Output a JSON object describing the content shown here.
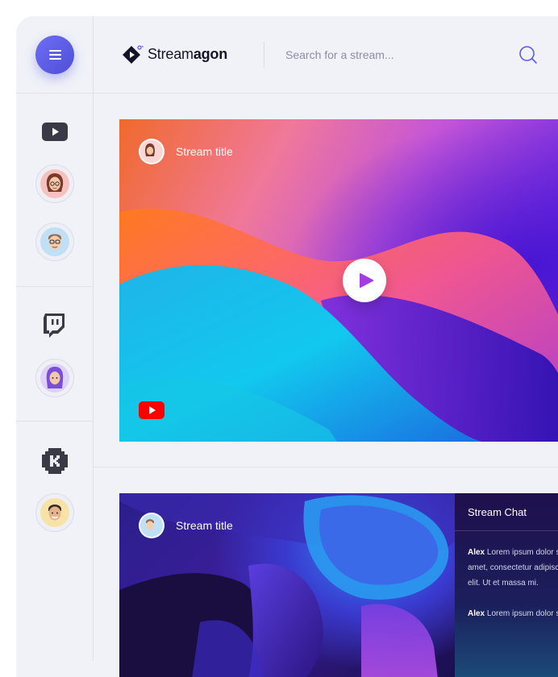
{
  "app": {
    "brand": {
      "name_regular": "Stream",
      "name_bold": "agon"
    },
    "search": {
      "placeholder": "Search for a stream..."
    }
  },
  "sidebar": {
    "groups": [
      {
        "platform": "youtube-icon",
        "channels": [
          "streamer-female-1",
          "streamer-male-glasses"
        ]
      },
      {
        "platform": "twitch-icon",
        "channels": [
          "streamer-female-purple"
        ]
      },
      {
        "platform": "kick-icon",
        "channels": [
          "streamer-male-2"
        ]
      }
    ]
  },
  "streams": [
    {
      "title": "Stream title",
      "platform": "youtube-icon"
    },
    {
      "title": "Stream title"
    }
  ],
  "chat": {
    "title": "Stream Chat",
    "messages": [
      {
        "user": "Alex",
        "lines": [
          "Lorem ipsum dolor sit",
          "amet, consectetur adipiscing",
          "elit. Ut et massa mi."
        ]
      },
      {
        "user": "Alex",
        "lines": [
          "Lorem ipsum dolor sit"
        ]
      }
    ]
  },
  "colors": {
    "accent": "#5b5be8",
    "youtube": "#ff0000",
    "twitch": "#3a3a46"
  }
}
